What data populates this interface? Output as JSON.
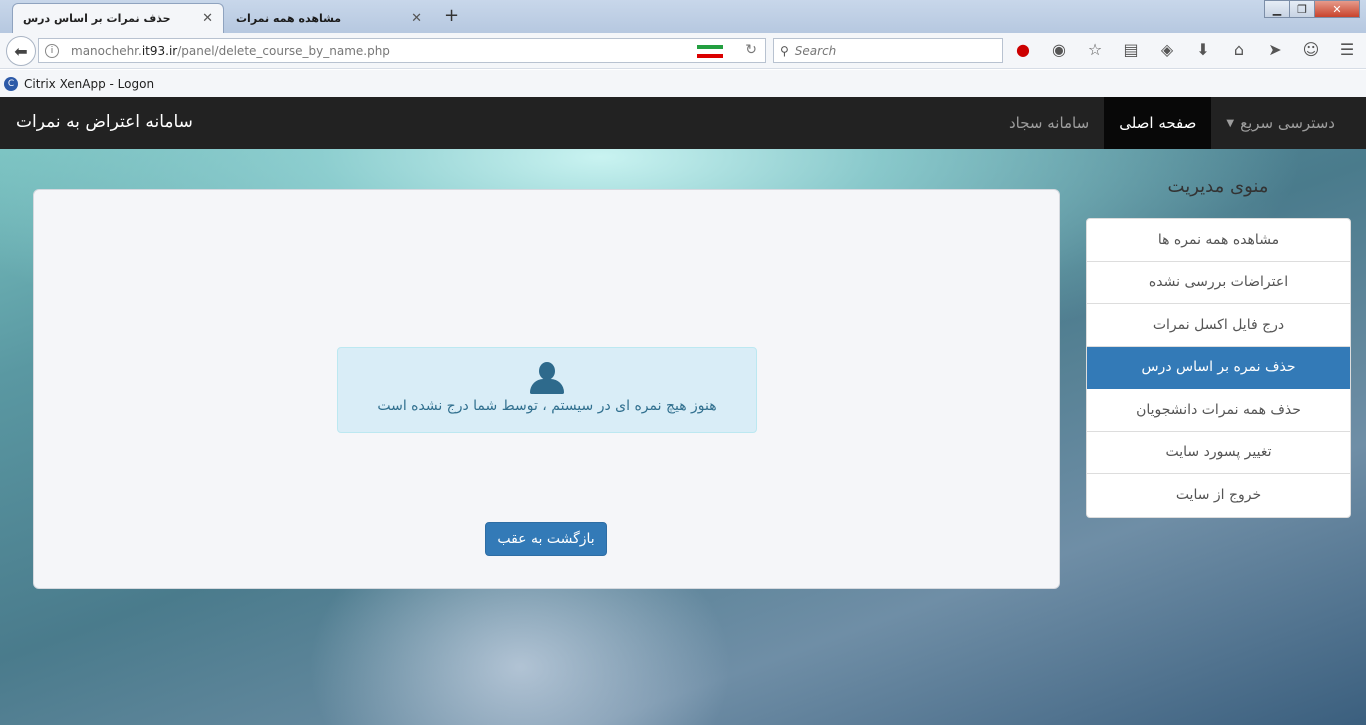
{
  "browser": {
    "tabs": [
      {
        "title": "حذف نمرات بر اساس درس",
        "active": true
      },
      {
        "title": "مشاهده همه نمرات",
        "active": false
      }
    ],
    "url_prefix": "manochehr.",
    "url_domain": "it93.ir",
    "url_path": "/panel/delete_course_by_name.php",
    "search_placeholder": "Search",
    "bookmark": "Citrix XenApp - Logon",
    "flag_colors": [
      "#239f40",
      "#ffffff",
      "#da0000"
    ]
  },
  "navbar": {
    "brand": "سامانه اعتراض به نمرات",
    "links": [
      {
        "label": "دسترسی سریع",
        "dropdown": true,
        "active": false
      },
      {
        "label": "صفحه اصلی",
        "active": true
      },
      {
        "label": "سامانه سجاد",
        "active": false
      }
    ]
  },
  "sidebar": {
    "title": "منوی مدیریت",
    "items": [
      {
        "label": "مشاهده همه نمره ها",
        "active": false
      },
      {
        "label": "اعتراضات بررسی نشده",
        "active": false
      },
      {
        "label": "درج فایل اکسل نمرات",
        "active": false
      },
      {
        "label": "حذف نمره بر اساس درس",
        "active": true
      },
      {
        "label": "حذف همه نمرات دانشجویان",
        "active": false
      },
      {
        "label": "تغییر پسورد سایت",
        "active": false
      },
      {
        "label": "خروج از سایت",
        "active": false
      }
    ]
  },
  "main": {
    "alert_icon": "user-icon",
    "alert_text": "هنوز هیچ نمره ای در سیستم ، توسط شما درج نشده است",
    "back_button": "بازگشت به عقب"
  },
  "colors": {
    "primary": "#337ab7",
    "alert_bg": "#d9edf7",
    "alert_text": "#31708f",
    "navbar_bg": "#222222"
  }
}
